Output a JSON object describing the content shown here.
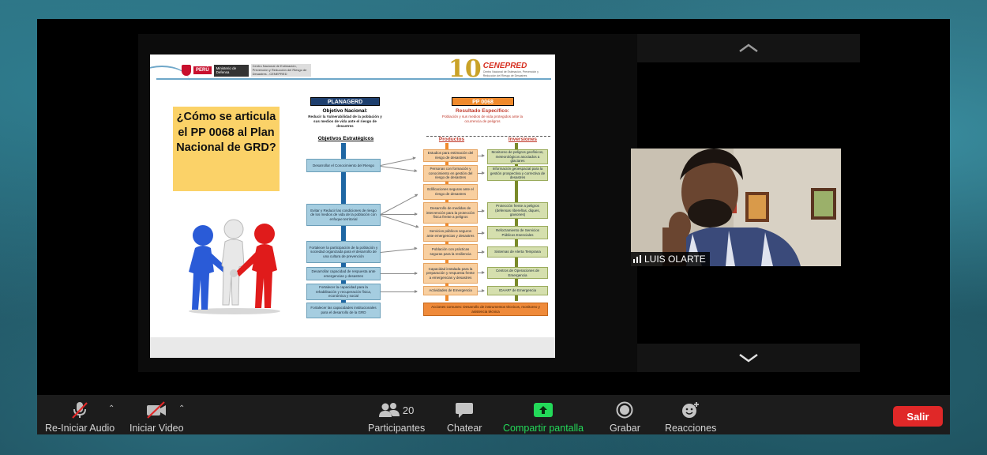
{
  "participant": {
    "name": "LUIS OLARTE"
  },
  "toolbar": {
    "audio_label": "Re-Iniciar Audio",
    "video_label": "Iniciar Video",
    "participants_label": "Participantes",
    "participants_count": "20",
    "chat_label": "Chatear",
    "share_label": "Compartir pantalla",
    "record_label": "Grabar",
    "reactions_label": "Reacciones",
    "leave_label": "Salir"
  },
  "slide": {
    "gov": {
      "peru": "PERÚ",
      "ministry": "Ministerio de Defensa",
      "center": "Centro Nacional de Estimación, Prevención y Reducción del Riesgo de Desastres - CENEPRED"
    },
    "cenepred_logo": {
      "name": "CENEPRED",
      "sub": "Centro Nacional de Estimación, Prevención y Reducción del Riesgo de Desastres"
    },
    "question": "¿Cómo se articula el PP 0068 al Plan Nacional de GRD?",
    "planagerd_header": "PLANAGERD",
    "pp_header": "PP 0068",
    "national_objective_title": "Objetivo Nacional:",
    "national_objective_text": "Reducir la Vulnerabilidad de la población y sus medios de vida ante el riesgo de desastres",
    "specific_result_title": "Resultado Específico:",
    "specific_result_text": "Población y sus medios de vida protegidos ante la ocurrencia de peligros",
    "strategic_objectives_title": "Objetivos Estratégicos",
    "products_title": "Productos",
    "investments_title": "Inversiones",
    "strategic_objectives": [
      "Desarrollar el Conocimiento del Riesgo",
      "Evitar y Reducir las condiciones de riesgo de los medios de vida de la población con enfoque territorial",
      "Fortalecer la participación de la población y sociedad organizada para el desarrollo de una cultura de prevención",
      "Desarrollar capacidad de respuesta ante emergencias y desastres",
      "Fortalecer la capacidad para la rehabilitación y recuperación física, económica y social",
      "Fortalecer las capacidades institucionales para el desarrollo de la GRD"
    ],
    "products": [
      "Estudios para estimación del riesgo de desastres",
      "Personas con formación y conocimiento en gestión del riesgo de desastres",
      "Edificaciones seguras ante el riesgo de desastres",
      "Desarrollo de medidas de intervención para la protección física frente a peligros",
      "Servicios públicos seguros ante emergencias y desastres",
      "Población con prácticas seguras para la resiliencia",
      "Capacidad instalada para la preparación y respuesta frente a emergencias y desastres",
      "Actividades de Emergencia"
    ],
    "investments": [
      "Monitoreo de peligros geofísicos, meteorológicos asociados a glaciares",
      "Información geoespacial para la gestión prospectiva y correctiva de desastres",
      "Protección frente a peligros (defensas ribereñas, diques, gaviones)",
      "Reforzamiento de Servicios Públicos Esenciales",
      "Sistemas de Alerta Temprana",
      "Centros de Operaciones de Emergencia",
      "IDAAR* de Emergencia"
    ],
    "common_actions": "Acciones comunes: Desarrollo de instrumentos técnicos, monitoreo y asistencia técnica"
  },
  "colors": {
    "toolbar_bg": "#1c1c1c",
    "share_accent": "#23d959",
    "leave_button": "#e02828",
    "planagerd_header": "#1e3f6e",
    "pp_header": "#f08a2c",
    "question_box": "#fbd268"
  },
  "icons": [
    "microphone-muted-icon",
    "video-off-icon",
    "participants-icon",
    "chat-icon",
    "share-screen-icon",
    "record-icon",
    "reactions-icon",
    "chevron-up-icon",
    "chevron-down-icon",
    "signal-bars-icon"
  ]
}
